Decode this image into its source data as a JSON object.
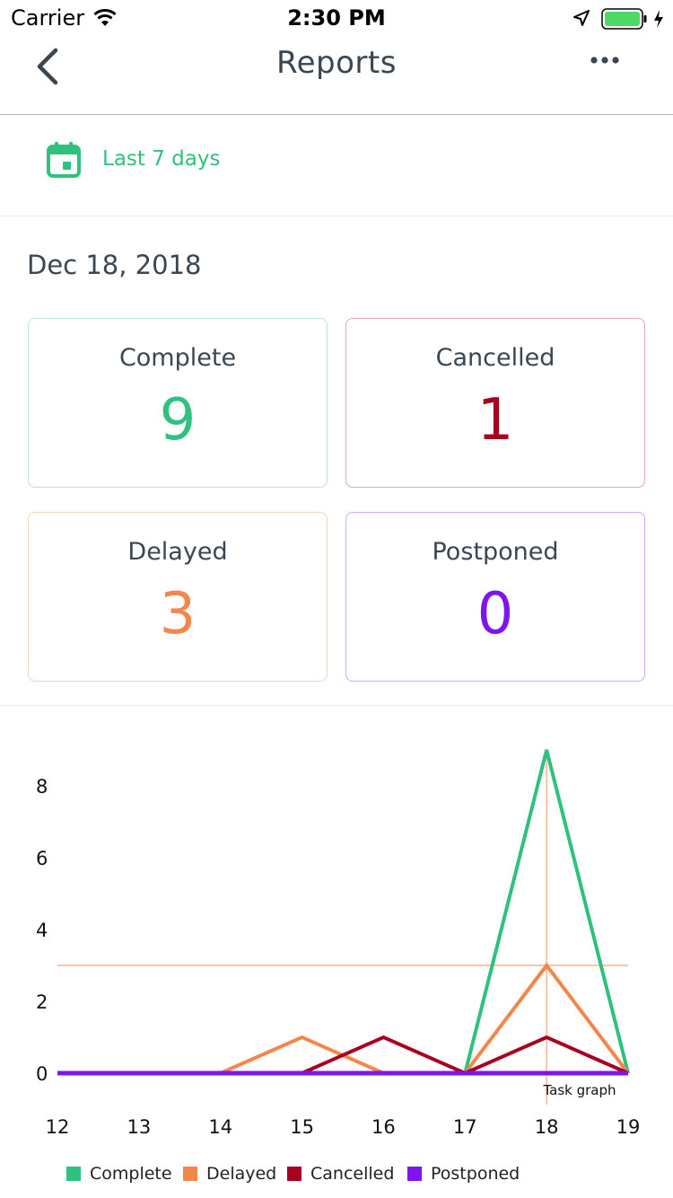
{
  "status_bar": {
    "carrier": "Carrier",
    "time": "2:30 PM"
  },
  "nav": {
    "title": "Reports"
  },
  "filter": {
    "range_label": "Last 7 days"
  },
  "report": {
    "date": "Dec 18, 2018",
    "cards": [
      {
        "label": "Complete",
        "value": "9",
        "color": "#2ec27e",
        "border": "#b7e8d0"
      },
      {
        "label": "Cancelled",
        "value": "1",
        "color": "#a8001f",
        "border": "#e8a6b2"
      },
      {
        "label": "Delayed",
        "value": "3",
        "color": "#f5864a",
        "border": "#f9d4bd"
      },
      {
        "label": "Postponed",
        "value": "0",
        "color": "#7f14ef",
        "border": "#d4a8f5"
      }
    ]
  },
  "chart_data": {
    "type": "line",
    "title": "",
    "annotation": "Task graph",
    "xlabel": "",
    "ylabel": "",
    "x": [
      12,
      13,
      14,
      15,
      16,
      17,
      18,
      19
    ],
    "xlim": [
      12,
      19
    ],
    "ylim": [
      0,
      9
    ],
    "yticks": [
      0,
      2,
      4,
      6,
      8
    ],
    "highlight": {
      "x": 18,
      "y": 3
    },
    "series": [
      {
        "name": "Complete",
        "color": "#2ec27e",
        "values": [
          0,
          0,
          0,
          0,
          0,
          0,
          9,
          0
        ]
      },
      {
        "name": "Delayed",
        "color": "#f5864a",
        "values": [
          0,
          0,
          0,
          1,
          0,
          0,
          3,
          0
        ]
      },
      {
        "name": "Cancelled",
        "color": "#a8001f",
        "values": [
          0,
          0,
          0,
          0,
          1,
          0,
          1,
          0
        ]
      },
      {
        "name": "Postponed",
        "color": "#7f14ef",
        "values": [
          0,
          0,
          0,
          0,
          0,
          0,
          0,
          0
        ]
      }
    ]
  }
}
